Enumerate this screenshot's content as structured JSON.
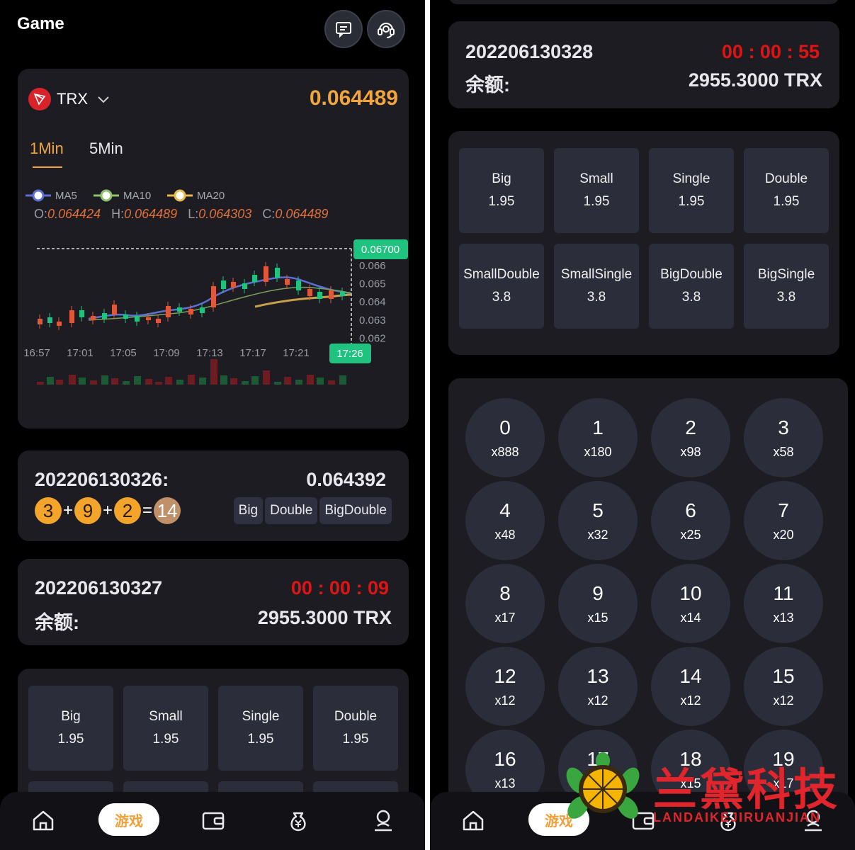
{
  "header": {
    "title": "Game"
  },
  "ticker": {
    "coin": "TRX",
    "price": "0.064489",
    "tabs": [
      "1Min",
      "5Min"
    ]
  },
  "ma_legend": [
    "MA5",
    "MA10",
    "MA20"
  ],
  "ohlc": {
    "o_label": "O:",
    "o": "0.064424",
    "h_label": "H:",
    "h": "0.064489",
    "l_label": "L:",
    "l": "0.064303",
    "c_label": "C:",
    "c": "0.064489"
  },
  "chart_data": {
    "type": "candlestick",
    "y_ticks": [
      "0.066",
      "0.065",
      "0.064",
      "0.063",
      "0.062"
    ],
    "x_ticks": [
      "16:57",
      "17:01",
      "17:05",
      "17:09",
      "17:13",
      "17:17",
      "17:21"
    ],
    "current_price_label": "0.06700",
    "current_time_label": "17:26",
    "ylim": [
      0.0615,
      0.067
    ]
  },
  "last_result": {
    "period": "202206130326:",
    "price": "0.064392",
    "balls": [
      "3",
      "9",
      "2"
    ],
    "plus": "+",
    "equals": "=",
    "sum": "14",
    "tags": [
      "Big",
      "Double",
      "BigDouble"
    ]
  },
  "left_current": {
    "period": "202206130327",
    "countdown": "00 : 00 : 09",
    "balance_label": "余额:",
    "balance": "2955.3000 TRX"
  },
  "right_current": {
    "period": "202206130328",
    "countdown": "00 : 00 : 55",
    "balance_label": "余额:",
    "balance": "2955.3000 TRX"
  },
  "bets": [
    {
      "label": "Big",
      "odds": "1.95"
    },
    {
      "label": "Small",
      "odds": "1.95"
    },
    {
      "label": "Single",
      "odds": "1.95"
    },
    {
      "label": "Double",
      "odds": "1.95"
    },
    {
      "label": "SmallDouble",
      "odds": "3.8"
    },
    {
      "label": "SmallSingle",
      "odds": "3.8"
    },
    {
      "label": "BigDouble",
      "odds": "3.8"
    },
    {
      "label": "BigSingle",
      "odds": "3.8"
    }
  ],
  "numbers": [
    {
      "n": "0",
      "x": "x888"
    },
    {
      "n": "1",
      "x": "x180"
    },
    {
      "n": "2",
      "x": "x98"
    },
    {
      "n": "3",
      "x": "x58"
    },
    {
      "n": "4",
      "x": "x48"
    },
    {
      "n": "5",
      "x": "x32"
    },
    {
      "n": "6",
      "x": "x25"
    },
    {
      "n": "7",
      "x": "x20"
    },
    {
      "n": "8",
      "x": "x17"
    },
    {
      "n": "9",
      "x": "x15"
    },
    {
      "n": "10",
      "x": "x14"
    },
    {
      "n": "11",
      "x": "x13"
    },
    {
      "n": "12",
      "x": "x12"
    },
    {
      "n": "13",
      "x": "x12"
    },
    {
      "n": "14",
      "x": "x12"
    },
    {
      "n": "15",
      "x": "x12"
    },
    {
      "n": "16",
      "x": "x13"
    },
    {
      "n": "17",
      "x": "x14"
    },
    {
      "n": "18",
      "x": "x15"
    },
    {
      "n": "19",
      "x": "x17"
    }
  ],
  "nav": {
    "game_label": "游戏"
  },
  "watermark": {
    "cn": "兰黛科技",
    "en": "LANDAIKEJIRUANJIAN"
  },
  "icons": [
    "message-icon",
    "support-icon",
    "home-icon",
    "wallet-icon",
    "money-bag-icon",
    "profile-icon",
    "chevron-down-icon",
    "trx-logo-icon"
  ]
}
